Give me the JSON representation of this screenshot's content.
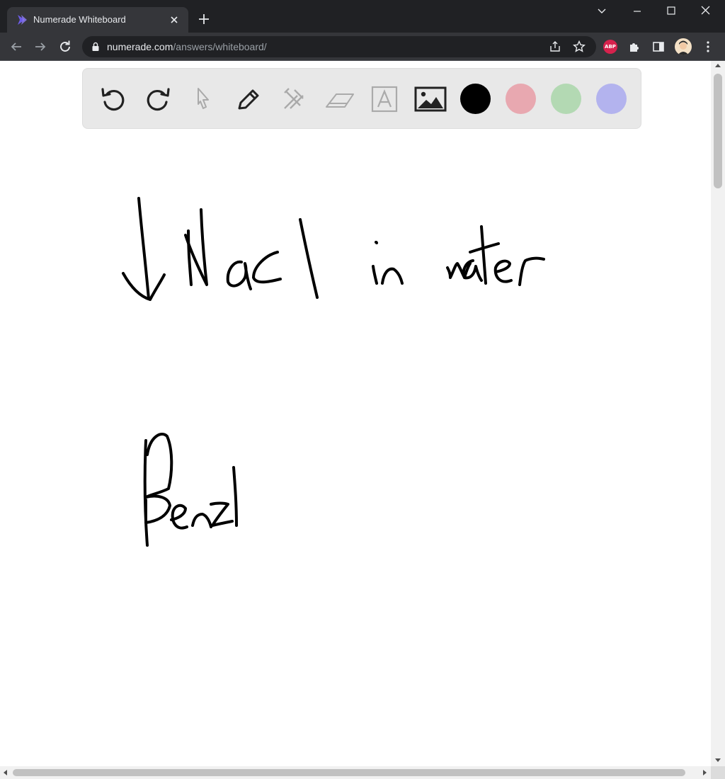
{
  "browser": {
    "tab": {
      "title": "Numerade Whiteboard",
      "favicon": "numerade-logo-icon"
    },
    "address": {
      "host": "numerade.com",
      "path": "/answers/whiteboard/"
    },
    "window_controls": [
      "chevron-down-icon",
      "minimize-icon",
      "maximize-icon",
      "close-icon"
    ],
    "extensions": [
      {
        "name": "adblock-plus",
        "label": "ABP"
      },
      {
        "name": "puzzle-icon"
      },
      {
        "name": "side-panel-icon"
      }
    ]
  },
  "whiteboard": {
    "tools": [
      "undo-icon",
      "redo-icon",
      "pointer-icon",
      "pen-icon",
      "tools-icon",
      "eraser-icon",
      "text-icon",
      "image-icon"
    ],
    "colors": [
      "#000000",
      "#e8a8b0",
      "#b3d9b3",
      "#b3b3ee"
    ],
    "ink_color": "#000000"
  }
}
